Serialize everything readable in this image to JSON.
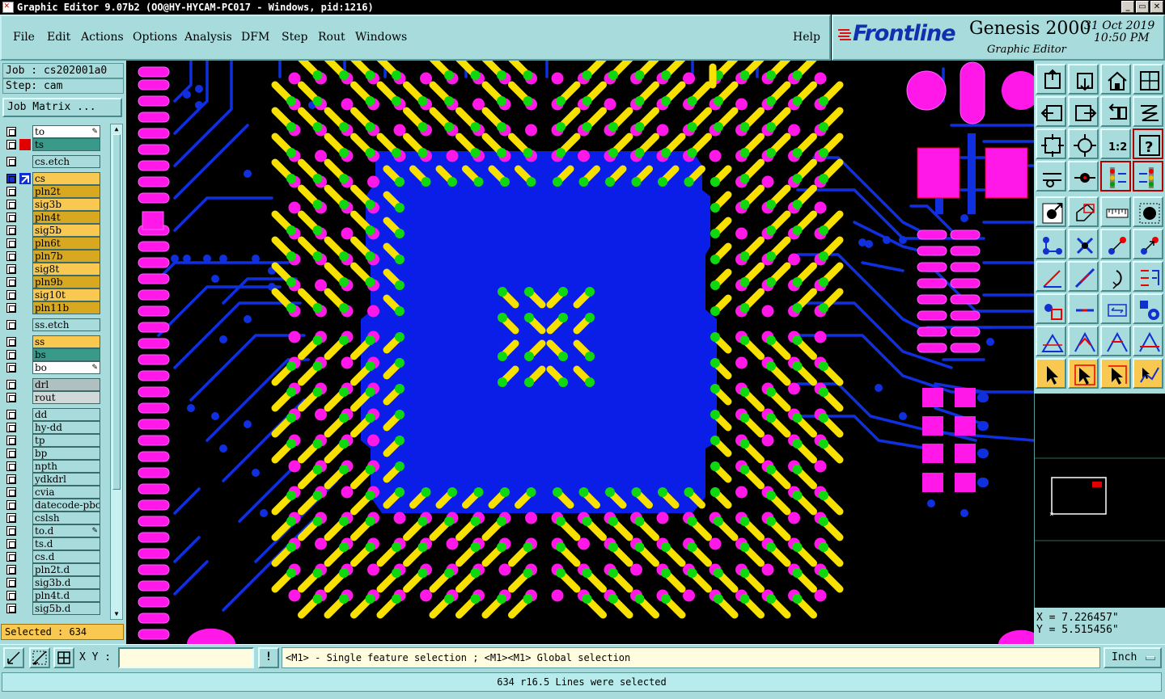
{
  "window": {
    "title": "Graphic Editor 9.07b2 (OO@HY-HYCAM-PC017 - Windows, pid:1216)",
    "buttons": [
      "_",
      "▭",
      "✕"
    ]
  },
  "menu": {
    "items": [
      "File",
      "Edit",
      "Actions",
      "Options",
      "Analysis",
      "DFM",
      "Step",
      "Rout",
      "Windows"
    ],
    "help": "Help"
  },
  "logo": {
    "brand": "Frontline",
    "product": "Genesis 2000",
    "subtitle": "Graphic Editor",
    "date": "31 Oct 2019",
    "time": "10:50 PM"
  },
  "job": {
    "job_label": "Job : cs202001a0",
    "step_label": "Step: cam",
    "matrix_button": "Job Matrix ..."
  },
  "layers": [
    {
      "name": "to",
      "color": "#ffffff",
      "edit": true
    },
    {
      "name": "ts",
      "color": "#3a9a8a",
      "swatch": "#e00000"
    },
    {
      "name": "cs.etch",
      "color": "#a8dcdc",
      "gap": true
    },
    {
      "name": "cs",
      "color": "#f8c850",
      "gap": true,
      "active": true
    },
    {
      "name": "pln2t",
      "color": "#d8a820"
    },
    {
      "name": "sig3b",
      "color": "#f8c850"
    },
    {
      "name": "pln4t",
      "color": "#d8a820"
    },
    {
      "name": "sig5b",
      "color": "#f8c850"
    },
    {
      "name": "pln6t",
      "color": "#d8a820"
    },
    {
      "name": "pln7b",
      "color": "#d8a820"
    },
    {
      "name": "sig8t",
      "color": "#f8c850"
    },
    {
      "name": "pln9b",
      "color": "#d8a820"
    },
    {
      "name": "sig10t",
      "color": "#f8c850"
    },
    {
      "name": "pln11b",
      "color": "#d8a820"
    },
    {
      "name": "ss.etch",
      "color": "#a8dcdc",
      "gap": true
    },
    {
      "name": "ss",
      "color": "#f8c850",
      "gap": true
    },
    {
      "name": "bs",
      "color": "#3a9a8a"
    },
    {
      "name": "bo",
      "color": "#ffffff",
      "edit": true
    },
    {
      "name": "drl",
      "color": "#b0c0c0",
      "gap": true
    },
    {
      "name": "rout",
      "color": "#d0d8d8"
    },
    {
      "name": "dd",
      "color": "#a8dcdc",
      "gap": true
    },
    {
      "name": "hy-dd",
      "color": "#a8dcdc"
    },
    {
      "name": "tp",
      "color": "#a8dcdc"
    },
    {
      "name": "bp",
      "color": "#a8dcdc"
    },
    {
      "name": "npth",
      "color": "#a8dcdc"
    },
    {
      "name": "ydkdrl",
      "color": "#a8dcdc"
    },
    {
      "name": "cvia",
      "color": "#a8dcdc"
    },
    {
      "name": "datecode-pbc",
      "color": "#a8dcdc"
    },
    {
      "name": "cslsh",
      "color": "#a8dcdc"
    },
    {
      "name": "to.d",
      "color": "#a8dcdc",
      "edit": true
    },
    {
      "name": "ts.d",
      "color": "#a8dcdc"
    },
    {
      "name": "cs.d",
      "color": "#a8dcdc"
    },
    {
      "name": "pln2t.d",
      "color": "#a8dcdc"
    },
    {
      "name": "sig3b.d",
      "color": "#a8dcdc"
    },
    {
      "name": "pln4t.d",
      "color": "#a8dcdc"
    },
    {
      "name": "sig5b.d",
      "color": "#a8dcdc"
    }
  ],
  "selected": "Selected : 634",
  "coords": {
    "x": "X = 7.226457\"",
    "y": "Y = 5.515456\""
  },
  "bottom": {
    "xy_label": "X Y :",
    "xy_value": "",
    "msg_button": "!",
    "hint": "<M1> - Single feature selection ; <M1><M1> Global selection",
    "units": "Inch"
  },
  "status": "634 r16.5 Lines were selected",
  "colors": {
    "panel": "#a8dcdc",
    "copper_fill": "#0a1ee8",
    "pad": "#ff18e8",
    "line": "#f8e000",
    "via": "#10d810"
  },
  "tools": [
    "pan-up-icon",
    "pan-down-icon",
    "home-icon",
    "window-split-icon",
    "pan-left-icon",
    "pan-right-icon",
    "zoom-back-icon",
    "redraw-icon",
    "zoom-fit-icon",
    "zoom-center-icon",
    "zoom-1to1-icon",
    "help-query-icon",
    "measure-icon",
    "snap-icon",
    "layer-display-icon",
    "layer-display-alt-icon",
    "add-feature-icon",
    "polygon-icon",
    "ruler-icon",
    "select-circle-icon",
    "net-connect-icon",
    "cross-icon",
    "move-icon",
    "copy-icon",
    "line-draw-icon",
    "line-edit-icon",
    "arc-icon",
    "pad-edit-icon",
    "attach-icon",
    "minus-icon",
    "resize-icon",
    "multi-pad-icon",
    "triangle-icon",
    "triangle-a-icon",
    "triangle-b-icon",
    "triangle-c-icon",
    "select-pointer-icon",
    "select-box-icon",
    "select-lasso-icon",
    "select-net-icon"
  ]
}
